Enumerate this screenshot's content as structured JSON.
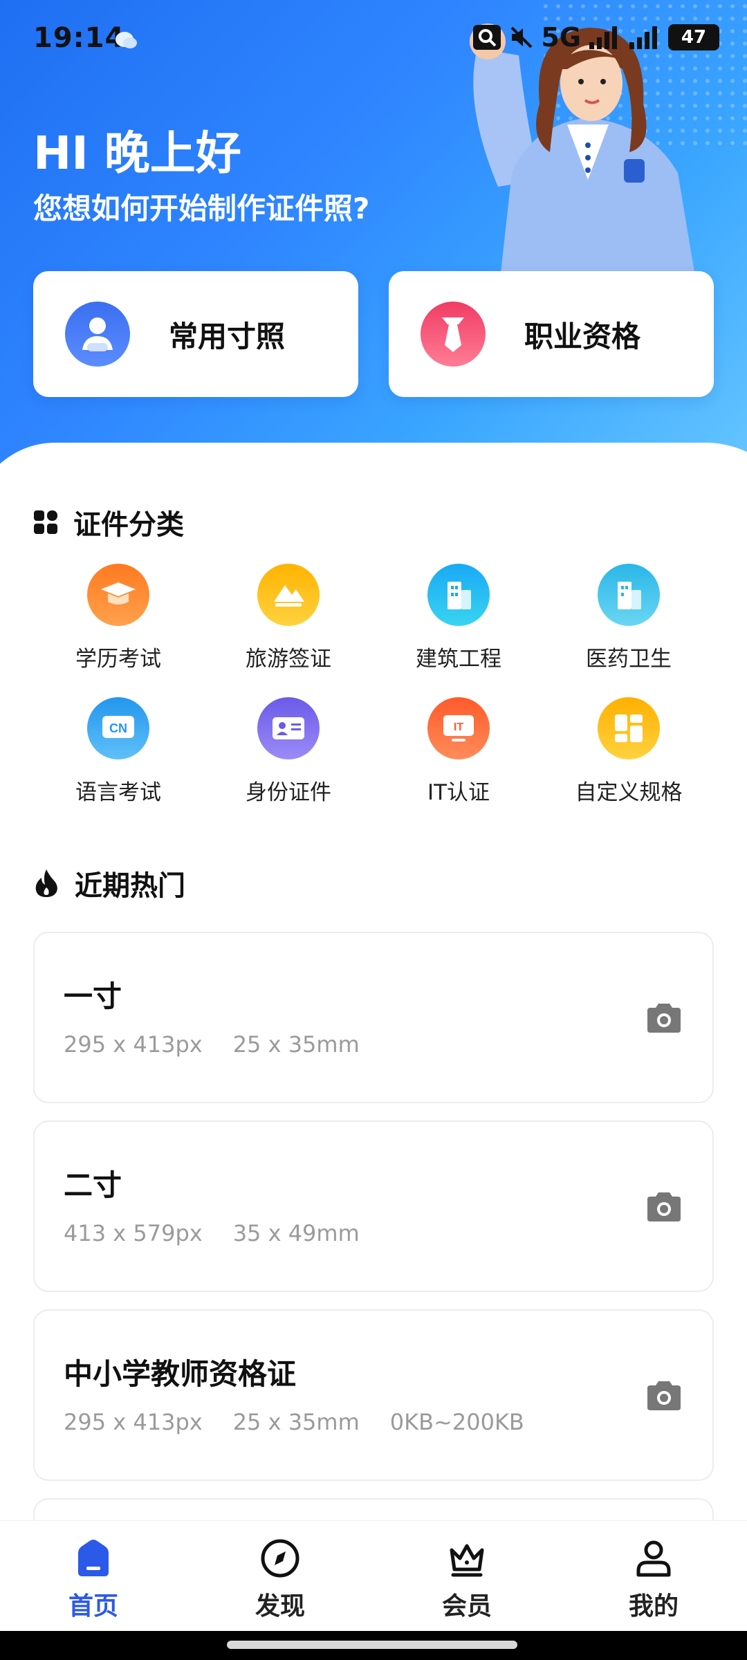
{
  "status_bar": {
    "time": "19:14",
    "network": "5G",
    "battery": "47"
  },
  "hero": {
    "greeting": "HI 晚上好",
    "subtitle": "您想如何开始制作证件照?"
  },
  "quick_actions": [
    {
      "label": "常用寸照",
      "icon": "person-icon",
      "color": "#3b6ff0"
    },
    {
      "label": "职业资格",
      "icon": "tie-icon",
      "color": "#f04a6f"
    }
  ],
  "categories": {
    "title": "证件分类",
    "items": [
      {
        "label": "学历考试",
        "icon": "graduation-cap-icon",
        "color": "#ff8a2a"
      },
      {
        "label": "旅游签证",
        "icon": "mountain-icon",
        "color": "#ffc21a"
      },
      {
        "label": "建筑工程",
        "icon": "building-icon",
        "color": "#21b8f5"
      },
      {
        "label": "医药卫生",
        "icon": "hospital-icon",
        "color": "#3fc4ea"
      },
      {
        "label": "语言考试",
        "icon": "cn-language-icon",
        "color": "#34a3f0"
      },
      {
        "label": "身份证件",
        "icon": "id-card-icon",
        "color": "#7d6df0"
      },
      {
        "label": "IT认证",
        "icon": "it-monitor-icon",
        "color": "#ff6a3c"
      },
      {
        "label": "自定义规格",
        "icon": "layout-icon",
        "color": "#ffbe12"
      }
    ]
  },
  "popular": {
    "title": "近期热门",
    "items": [
      {
        "name": "一寸",
        "px": "295 x 413px",
        "mm": "25 x 35mm",
        "size": ""
      },
      {
        "name": "二寸",
        "px": "413 x 579px",
        "mm": "35 x 49mm",
        "size": ""
      },
      {
        "name": "中小学教师资格证",
        "px": "295 x 413px",
        "mm": "25 x 35mm",
        "size": "0KB~200KB"
      }
    ]
  },
  "nav": [
    {
      "label": "首页",
      "icon": "home-icon",
      "active": true
    },
    {
      "label": "发现",
      "icon": "compass-icon",
      "active": false
    },
    {
      "label": "会员",
      "icon": "crown-icon",
      "active": false
    },
    {
      "label": "我的",
      "icon": "user-icon",
      "active": false
    }
  ],
  "colors": {
    "accent": "#2b59e8",
    "hero_start": "#1f6ff2",
    "hero_end": "#66c6ff"
  }
}
